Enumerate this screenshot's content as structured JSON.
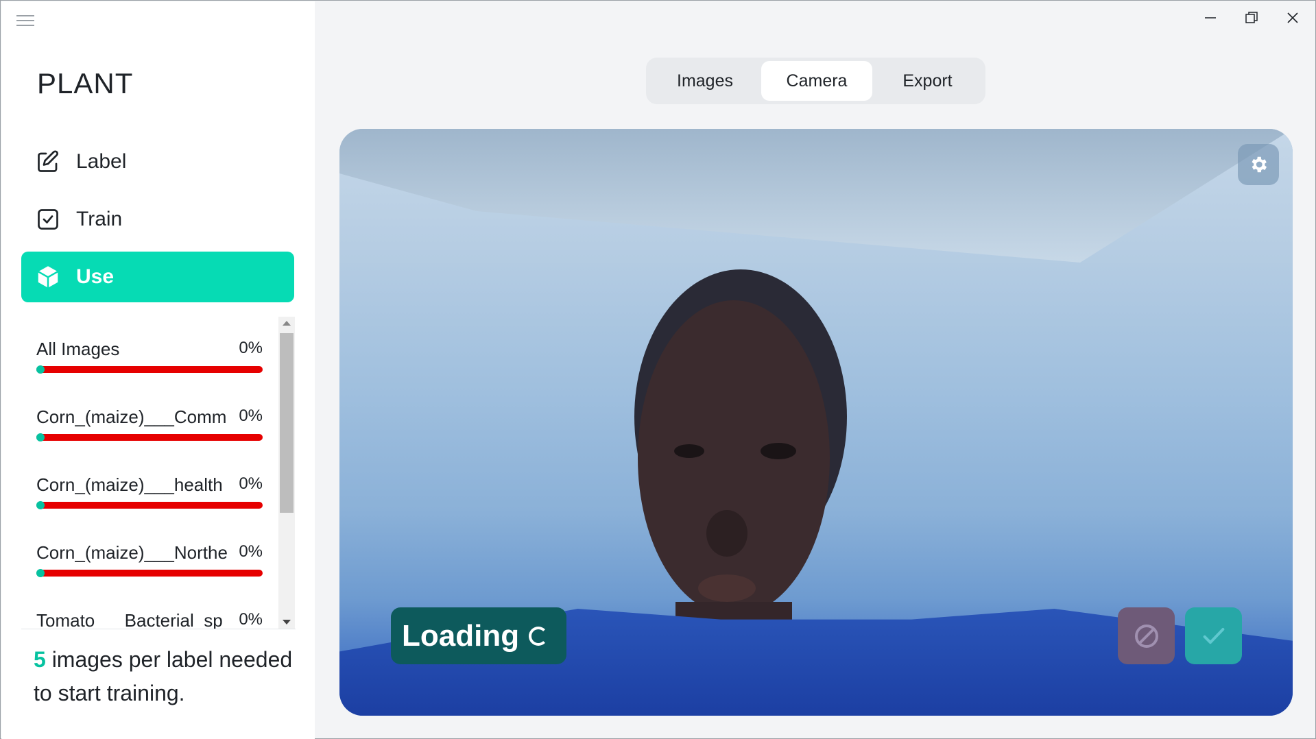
{
  "sidebar": {
    "app_title": "PLANT",
    "nav": [
      {
        "label": "Label",
        "icon": "edit-icon"
      },
      {
        "label": "Train",
        "icon": "checkbox-icon"
      },
      {
        "label": "Use",
        "icon": "cube-icon",
        "active": true
      }
    ],
    "labels": [
      {
        "name": "All Images",
        "percent": "0%",
        "progress": 0
      },
      {
        "name": "Corn_(maize)___Comm",
        "percent": "0%",
        "progress": 0
      },
      {
        "name": "Corn_(maize)___health",
        "percent": "0%",
        "progress": 0
      },
      {
        "name": "Corn_(maize)___Northe",
        "percent": "0%",
        "progress": 0
      },
      {
        "name": "Tomato___Bacterial_sp",
        "percent": "0%",
        "progress": 0
      }
    ],
    "hint": {
      "count": "5",
      "text": " images per label needed to start training."
    }
  },
  "tabs": [
    {
      "label": "Images",
      "active": false
    },
    {
      "label": "Camera",
      "active": true
    },
    {
      "label": "Export",
      "active": false
    }
  ],
  "camera": {
    "status": "Loading",
    "settings_icon": "gear-icon",
    "cancel_icon": "block-icon",
    "confirm_icon": "check-icon"
  },
  "colors": {
    "accent": "#06dbb4",
    "progress_track": "#e60000",
    "loading_bg": "#0d5a5c"
  }
}
